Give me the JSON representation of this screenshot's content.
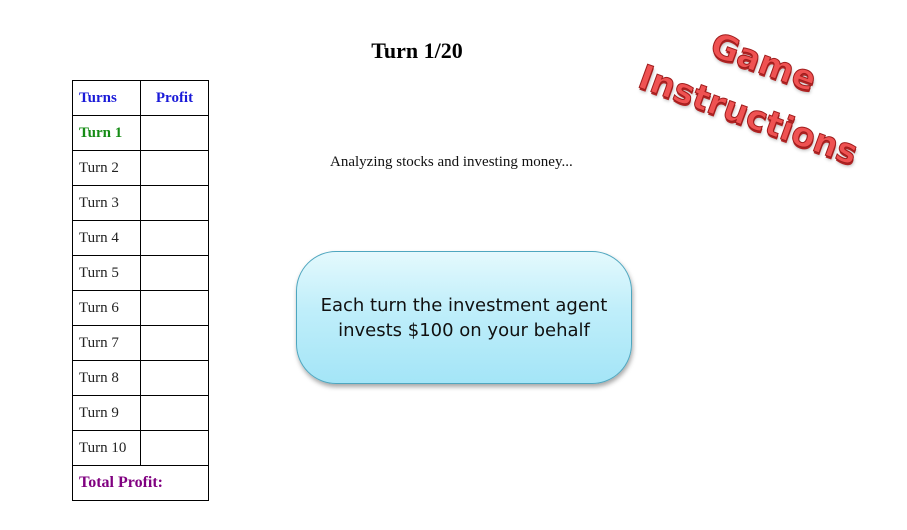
{
  "header": {
    "turn_title": "Turn 1/20"
  },
  "table": {
    "col_turns": "Turns",
    "col_profit": "Profit",
    "rows": [
      {
        "label": "Turn 1",
        "profit": ""
      },
      {
        "label": "Turn 2",
        "profit": ""
      },
      {
        "label": "Turn 3",
        "profit": ""
      },
      {
        "label": "Turn 4",
        "profit": ""
      },
      {
        "label": "Turn 5",
        "profit": ""
      },
      {
        "label": "Turn 6",
        "profit": ""
      },
      {
        "label": "Turn 7",
        "profit": ""
      },
      {
        "label": "Turn 8",
        "profit": ""
      },
      {
        "label": "Turn 9",
        "profit": ""
      },
      {
        "label": "Turn 10",
        "profit": ""
      }
    ],
    "total_label": "Total Profit:",
    "total_value": ""
  },
  "status": {
    "text": "Analyzing stocks and investing money..."
  },
  "info_bubble": {
    "text": "Each turn the investment agent invests $100 on your behalf"
  },
  "instructions_link": {
    "word1": "Game",
    "word2": "Instructions"
  },
  "colors": {
    "header_blue": "#1a1ad8",
    "current_turn_green": "#168c16",
    "total_purple": "#800080",
    "bubble_cyan": "#bfeefa",
    "instructions_red": "#ef5252"
  }
}
